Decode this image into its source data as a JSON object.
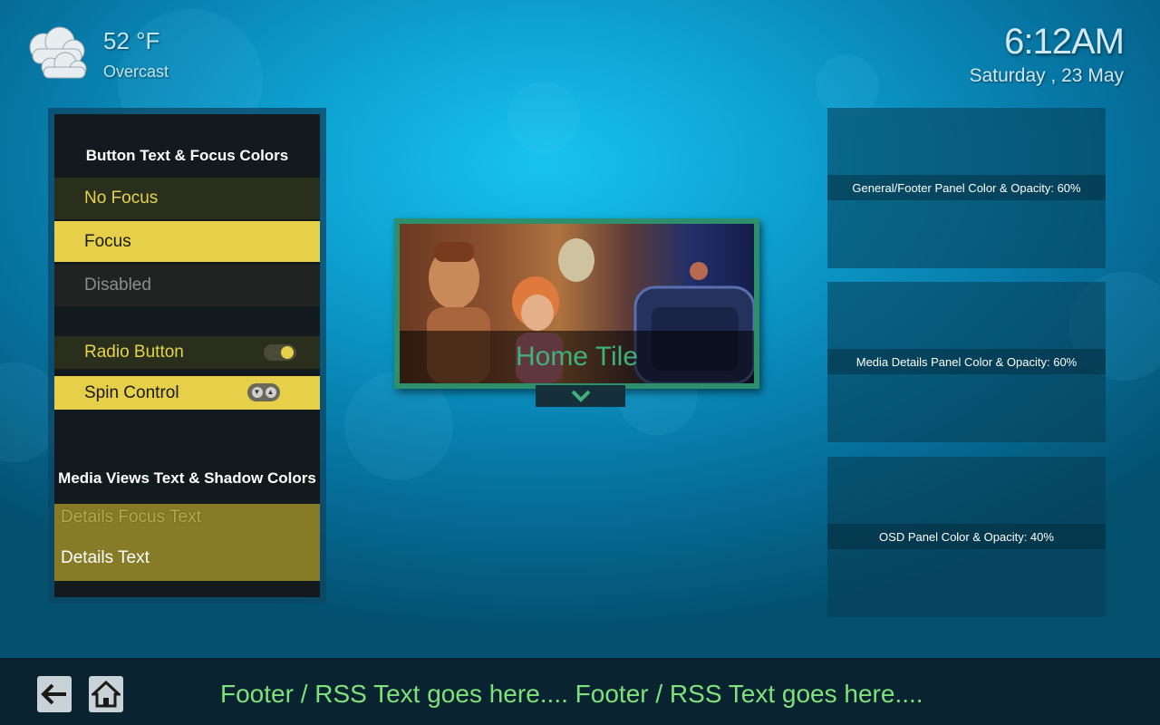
{
  "weather": {
    "temperature": "52 °F",
    "condition": "Overcast",
    "icon": "cloud-icon"
  },
  "clock": {
    "time": "6:12AM",
    "date": "Saturday , 23 May"
  },
  "left_panel": {
    "button_section_title": "Button Text & Focus Colors",
    "buttons": {
      "no_focus": "No Focus",
      "focus": "Focus",
      "disabled": "Disabled",
      "radio": "Radio Button",
      "spin": "Spin Control"
    },
    "media_section_title": "Media Views Text & Shadow Colors",
    "details_focus_text": "Details Focus Text",
    "details_text": "Details Text"
  },
  "home_tile": {
    "caption": "Home Tile",
    "arrow_icon": "chevron-down-icon"
  },
  "right_panels": [
    {
      "label": "General/Footer Panel Color & Opacity: 60%"
    },
    {
      "label": "Media Details Panel Color & Opacity: 60%"
    },
    {
      "label": "OSD Panel Color & Opacity: 40%"
    }
  ],
  "footer": {
    "rss_text": "Footer / RSS Text goes here....  Footer / RSS Text goes here....",
    "back_icon": "back-arrow-icon",
    "home_icon": "home-icon"
  },
  "colors": {
    "focus": "#e6cf49",
    "nofocus_text": "#e5d44a",
    "tile_border": "#2e8f6d",
    "tile_caption": "#3fb07e",
    "rss_text": "#7ee27a"
  }
}
